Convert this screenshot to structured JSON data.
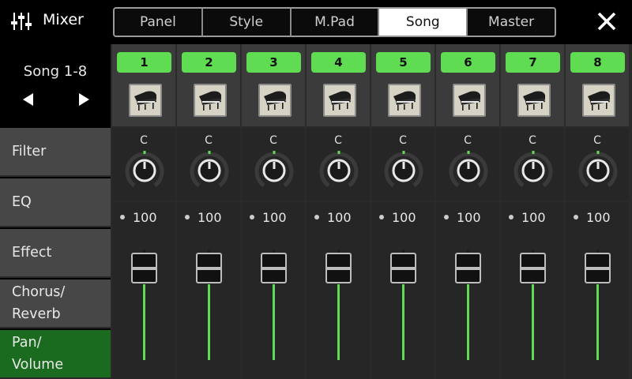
{
  "header": {
    "title": "Mixer",
    "tabs": [
      {
        "label": "Panel",
        "active": false
      },
      {
        "label": "Style",
        "active": false
      },
      {
        "label": "M.Pad",
        "active": false
      },
      {
        "label": "Song",
        "active": true
      },
      {
        "label": "Master",
        "active": false
      }
    ],
    "close_icon": "close-icon",
    "mixer_icon": "mixer-sliders-icon"
  },
  "sidebar": {
    "song_range": "Song 1-8",
    "prev_icon": "triangle-left-icon",
    "next_icon": "triangle-right-icon",
    "menu": [
      {
        "label": "Filter",
        "active": false
      },
      {
        "label": "EQ",
        "active": false
      },
      {
        "label": "Effect",
        "active": false
      },
      {
        "label": "Chorus/\nReverb",
        "active": false
      },
      {
        "label": "Pan/\nVolume",
        "active": true
      }
    ]
  },
  "channels": [
    {
      "number": "1",
      "voice_icon": "grand-piano-icon",
      "pan": "C",
      "volume": "100"
    },
    {
      "number": "2",
      "voice_icon": "grand-piano-icon",
      "pan": "C",
      "volume": "100"
    },
    {
      "number": "3",
      "voice_icon": "grand-piano-icon",
      "pan": "C",
      "volume": "100"
    },
    {
      "number": "4",
      "voice_icon": "grand-piano-icon",
      "pan": "C",
      "volume": "100"
    },
    {
      "number": "5",
      "voice_icon": "grand-piano-icon",
      "pan": "C",
      "volume": "100"
    },
    {
      "number": "6",
      "voice_icon": "grand-piano-icon",
      "pan": "C",
      "volume": "100"
    },
    {
      "number": "7",
      "voice_icon": "grand-piano-icon",
      "pan": "C",
      "volume": "100"
    },
    {
      "number": "8",
      "voice_icon": "grand-piano-icon",
      "pan": "C",
      "volume": "100"
    }
  ],
  "colors": {
    "accent_green": "#5fdc52",
    "active_menu": "#1a6b1f",
    "menu_bg": "#474747"
  }
}
